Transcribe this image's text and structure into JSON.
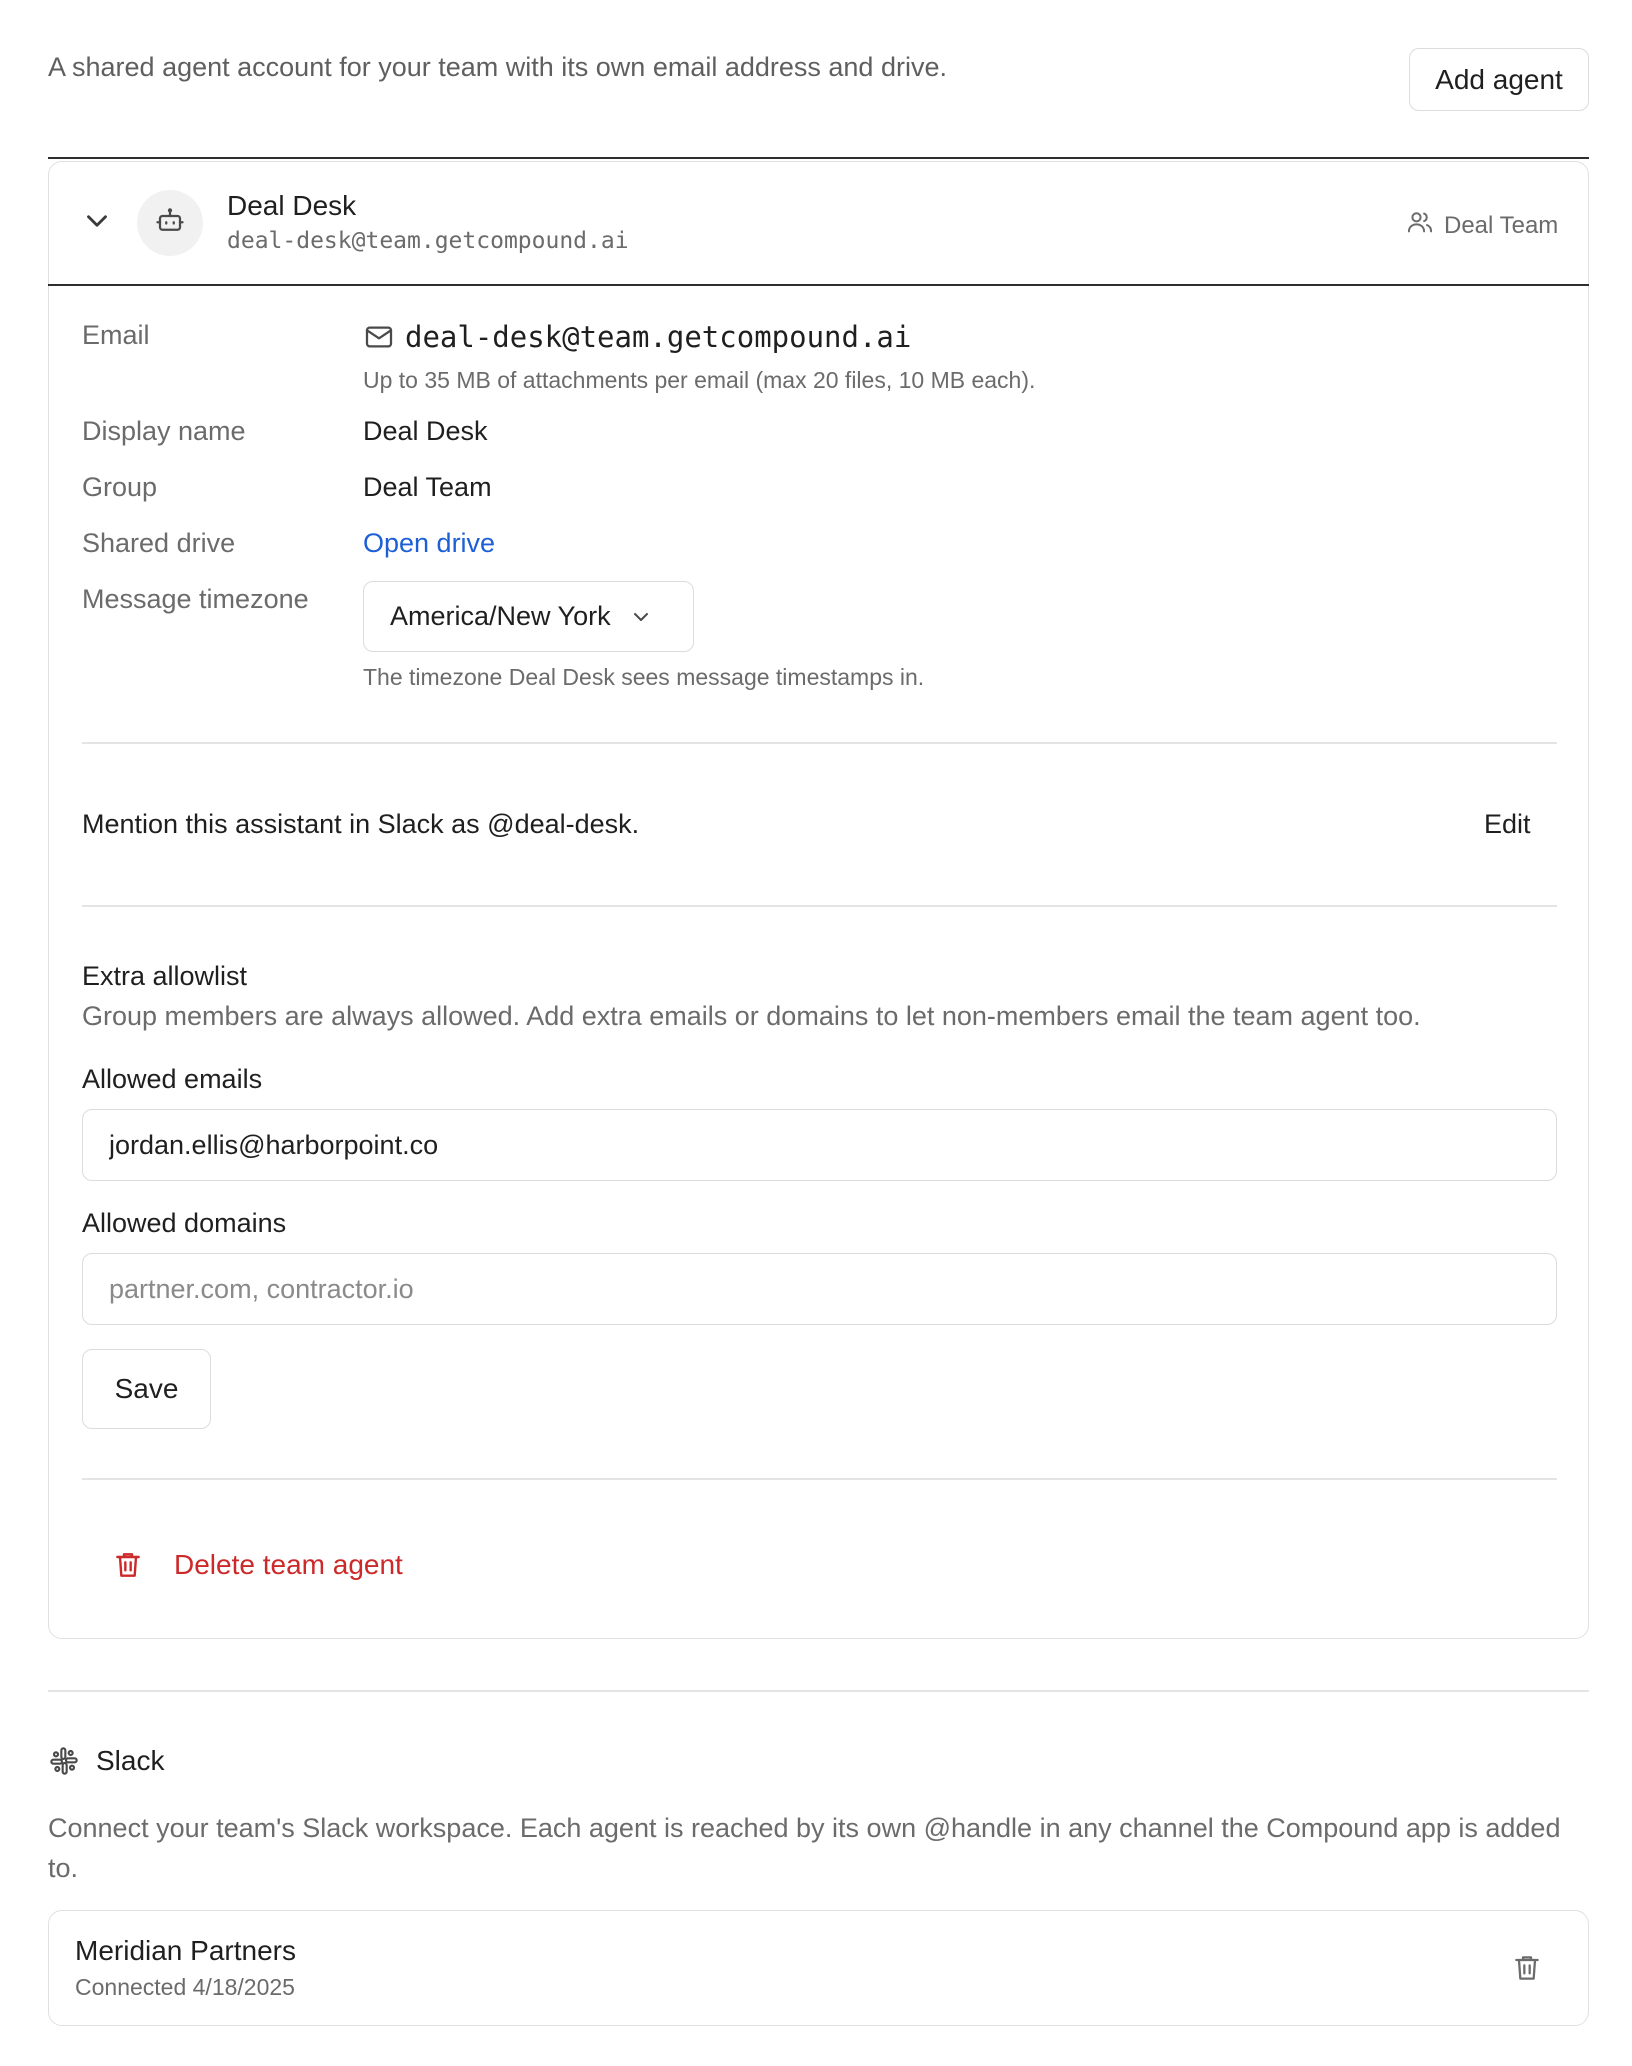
{
  "header": {
    "intro": "A shared agent account for your team with its own email address and drive.",
    "add_agent_label": "Add agent"
  },
  "agent": {
    "name": "Deal Desk",
    "email": "deal-desk@team.getcompound.ai",
    "group_tag": "Deal Team",
    "icons": {
      "expand": "chevron-down-icon",
      "avatar": "robot-icon",
      "group": "users-icon"
    }
  },
  "details": {
    "email_label": "Email",
    "email_value": "deal-desk@team.getcompound.ai",
    "attachment_note": "Up to 35 MB of attachments per email (max 20 files, 10 MB each).",
    "display_name_label": "Display name",
    "display_name_value": "Deal Desk",
    "group_label": "Group",
    "group_value": "Deal Team",
    "drive_label": "Shared drive",
    "drive_link": "Open drive",
    "timezone_label": "Message timezone",
    "timezone_value": "America/New York",
    "timezone_note": "The timezone Deal Desk sees message timestamps in."
  },
  "slack_mention": {
    "text": "Mention this assistant in Slack as @deal-desk.",
    "edit_label": "Edit"
  },
  "allowlist": {
    "title": "Extra allowlist",
    "description": "Group members are always allowed. Add extra emails or domains to let non-members email the team agent too.",
    "emails_label": "Allowed emails",
    "emails_value": "jordan.ellis@harborpoint.co",
    "domains_label": "Allowed domains",
    "domains_placeholder": "partner.com, contractor.io",
    "save_label": "Save"
  },
  "delete": {
    "label": "Delete team agent"
  },
  "slack": {
    "title": "Slack",
    "description": "Connect your team's Slack workspace. Each agent is reached by its own @handle in any channel the Compound app is added to.",
    "workspace": {
      "name": "Meridian Partners",
      "status": "Connected 4/18/2025"
    }
  },
  "colors": {
    "link": "#1d5fd6",
    "danger": "#cc2a2a",
    "muted_text": "#6b6b6b",
    "border": "#dcdcdc"
  }
}
